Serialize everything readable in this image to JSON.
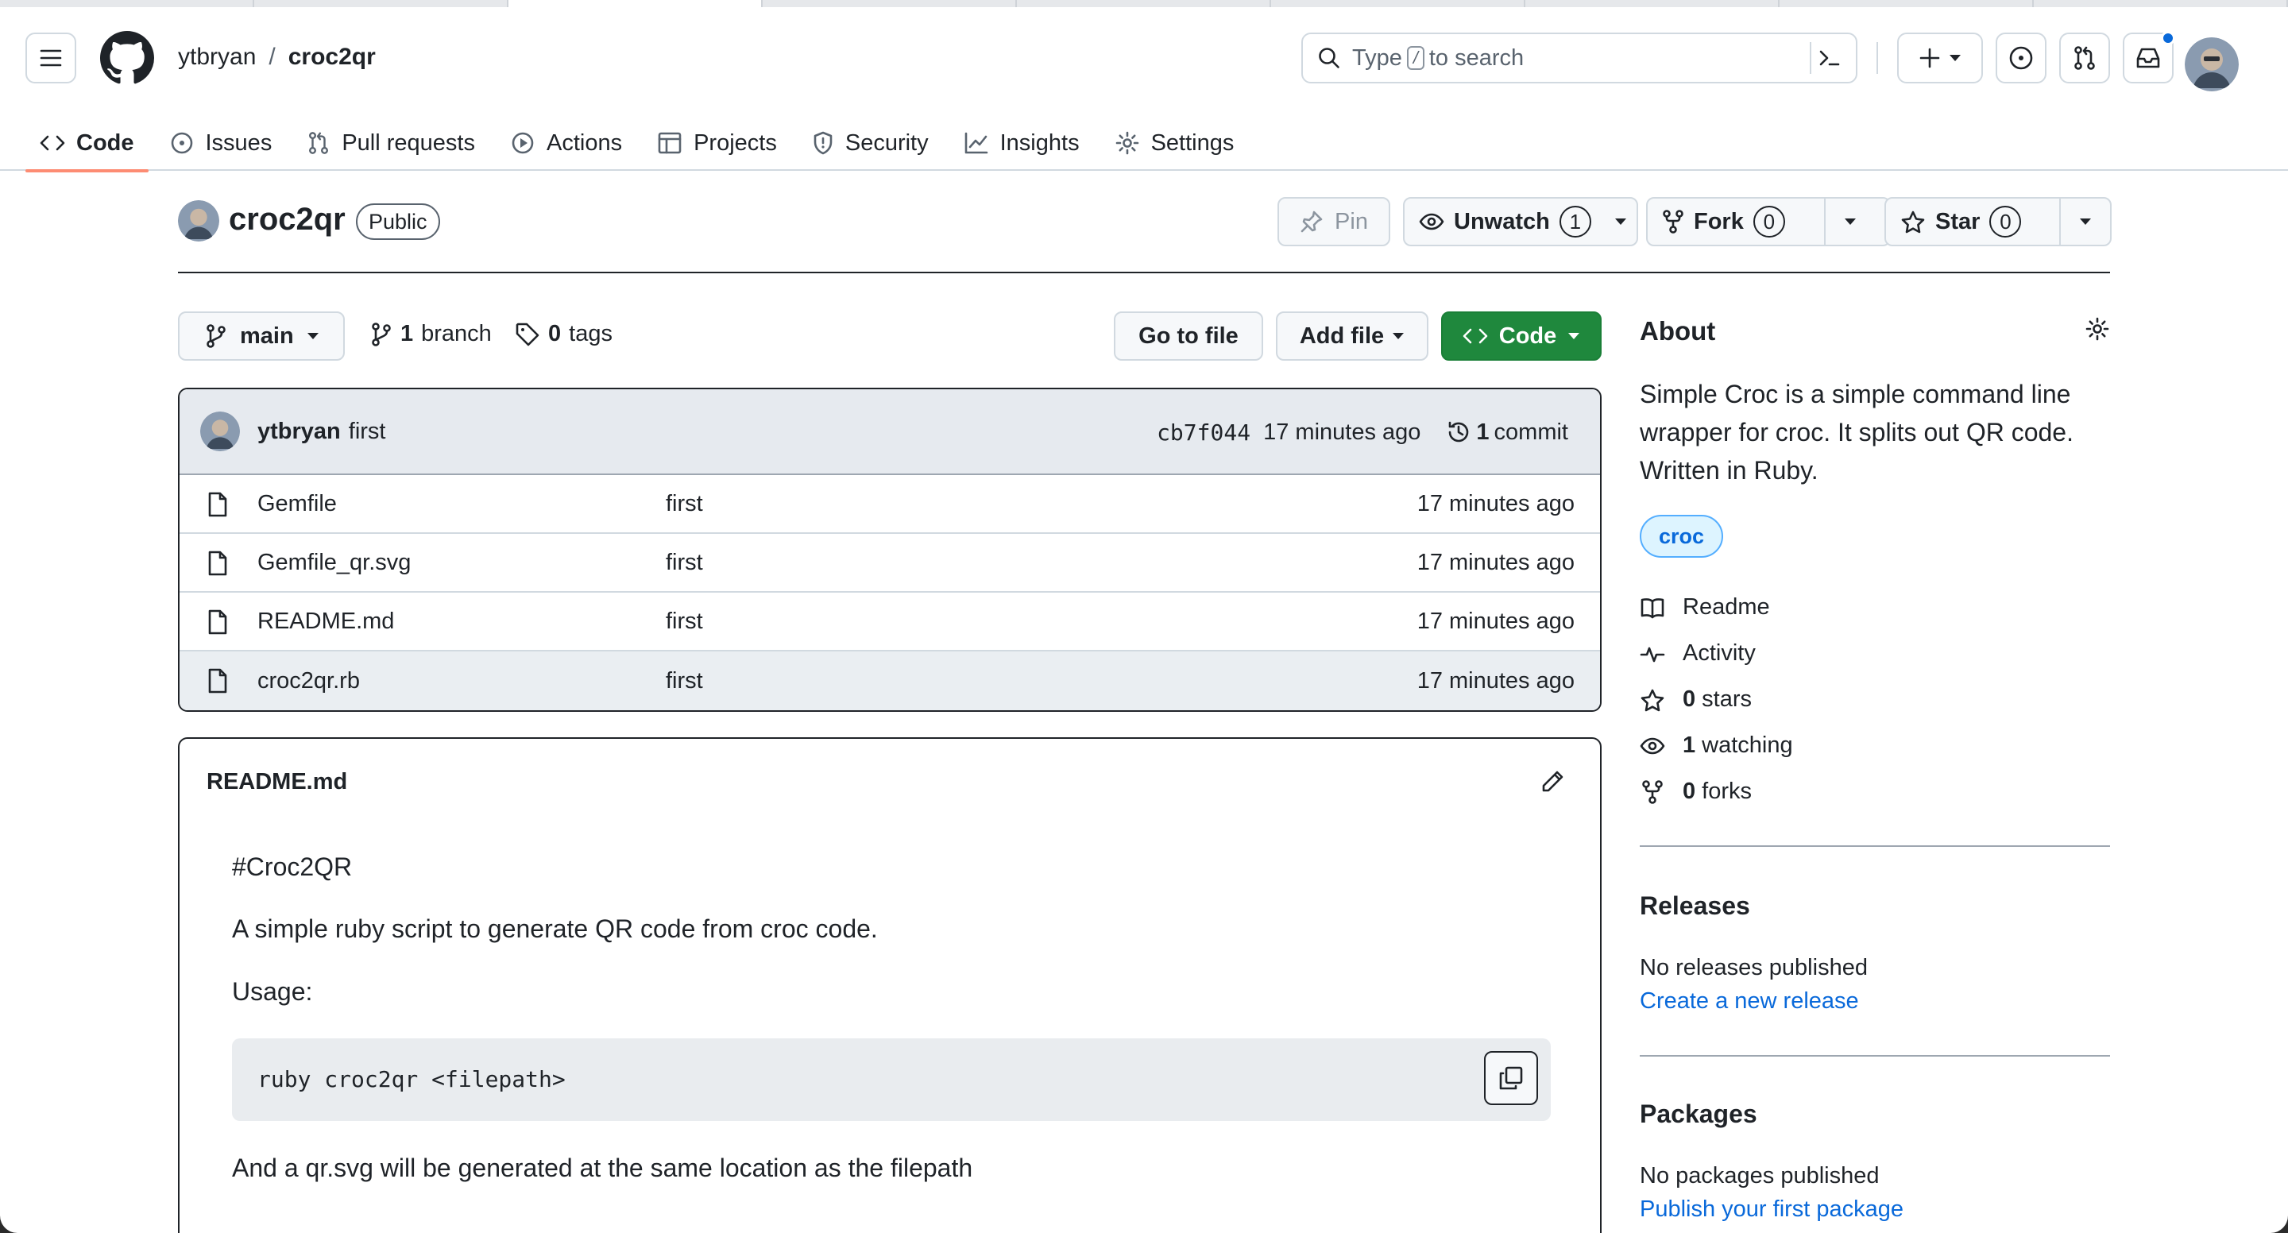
{
  "header": {
    "owner": "ytbryan",
    "separator": "/",
    "repo": "croc2qr",
    "search": {
      "prefix": "Type",
      "key": "/",
      "suffix": "to search"
    }
  },
  "nav": {
    "tabs": [
      {
        "label": "Code",
        "icon": "code-icon",
        "active": true
      },
      {
        "label": "Issues",
        "icon": "issue-opened-icon"
      },
      {
        "label": "Pull requests",
        "icon": "git-pull-request-icon"
      },
      {
        "label": "Actions",
        "icon": "play-icon"
      },
      {
        "label": "Projects",
        "icon": "table-icon"
      },
      {
        "label": "Security",
        "icon": "shield-icon"
      },
      {
        "label": "Insights",
        "icon": "graph-icon"
      },
      {
        "label": "Settings",
        "icon": "gear-icon"
      }
    ]
  },
  "repo": {
    "name": "croc2qr",
    "visibility": "Public",
    "pin_label": "Pin",
    "watch_label": "Unwatch",
    "watch_count": "1",
    "fork_label": "Fork",
    "fork_count": "0",
    "star_label": "Star",
    "star_count": "0"
  },
  "branch": {
    "current": "main",
    "branch_count": "1",
    "branch_label": "branch",
    "tag_count": "0",
    "tag_label": "tags",
    "go_to_file": "Go to file",
    "add_file": "Add file",
    "code": "Code"
  },
  "commit": {
    "author": "ytbryan",
    "message": "first",
    "sha": "cb7f044",
    "time": "17 minutes ago",
    "count": "1",
    "count_label": "commit"
  },
  "files": [
    {
      "name": "Gemfile",
      "message": "first",
      "time": "17 minutes ago"
    },
    {
      "name": "Gemfile_qr.svg",
      "message": "first",
      "time": "17 minutes ago"
    },
    {
      "name": "README.md",
      "message": "first",
      "time": "17 minutes ago"
    },
    {
      "name": "croc2qr.rb",
      "message": "first",
      "time": "17 minutes ago"
    }
  ],
  "readme": {
    "title": "README.md",
    "heading": "#Croc2QR",
    "para1": "A simple ruby script to generate QR code from croc code.",
    "usage": "Usage:",
    "code": "ruby croc2qr <filepath>",
    "para2": "And a qr.svg will be generated at the same location as the filepath"
  },
  "about": {
    "title": "About",
    "description": "Simple Croc is a simple command line wrapper for croc. It splits out QR code. Written in Ruby.",
    "topic": "croc",
    "readme": "Readme",
    "activity": "Activity",
    "stars_count": "0",
    "stars_label": "stars",
    "watching_count": "1",
    "watching_label": "watching",
    "forks_count": "0",
    "forks_label": "forks"
  },
  "releases": {
    "title": "Releases",
    "empty": "No releases published",
    "link": "Create a new release"
  },
  "packages": {
    "title": "Packages",
    "empty": "No packages published",
    "link": "Publish your first package"
  },
  "colors": {
    "accent_green": "#1f883d",
    "link_blue": "#0969da",
    "nav_underline": "#fd8c73"
  }
}
